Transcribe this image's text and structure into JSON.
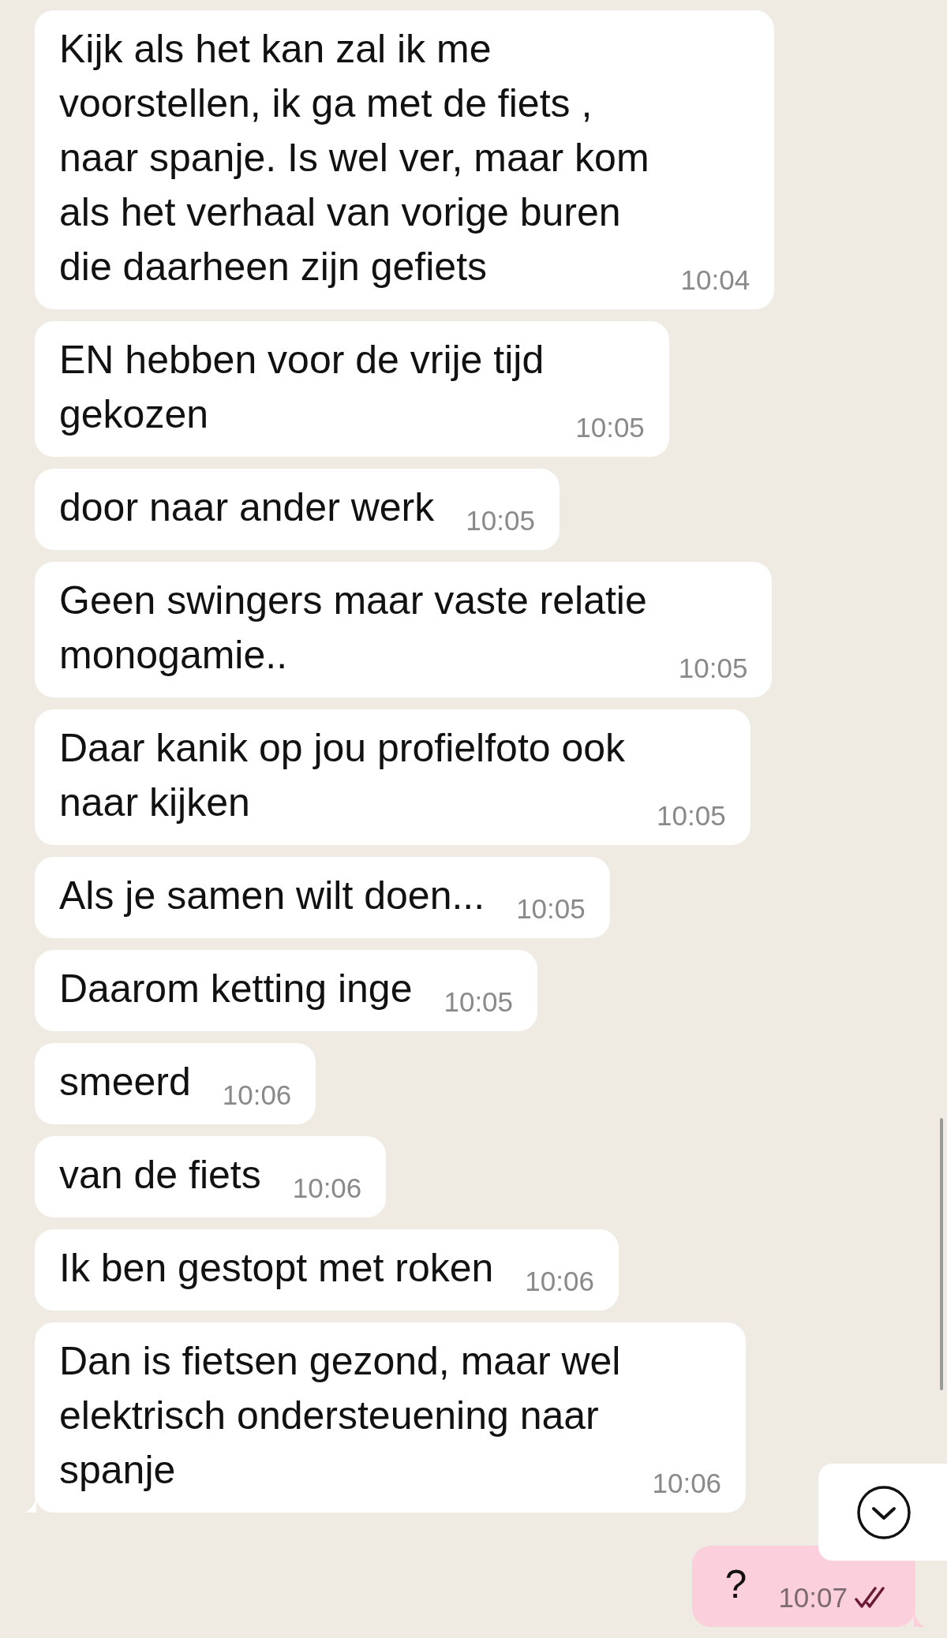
{
  "messages": [
    {
      "kind": "incoming",
      "text": "Kijk als het kan zal ik me\nvoorstellen, ik ga met de fiets ,\nnaar spanje. Is wel ver, maar kom\nals het verhaal van vorige buren\ndie daarheen zijn gefiets",
      "time": "10:04"
    },
    {
      "kind": "incoming",
      "text": "EN hebben voor de vrije tijd\ngekozen",
      "time": "10:05"
    },
    {
      "kind": "incoming",
      "text": "door naar ander werk",
      "time": "10:05"
    },
    {
      "kind": "incoming",
      "text": "Geen swingers maar vaste relatie\nmonogamie..",
      "time": "10:05"
    },
    {
      "kind": "incoming",
      "text": "Daar kanik op jou profielfoto ook\nnaar kijken",
      "time": "10:05"
    },
    {
      "kind": "incoming",
      "text": "Als je samen wilt doen...",
      "time": "10:05"
    },
    {
      "kind": "incoming",
      "text": "Daarom ketting inge",
      "time": "10:05"
    },
    {
      "kind": "incoming",
      "text": "smeerd",
      "time": "10:06"
    },
    {
      "kind": "incoming",
      "text": "van de fiets",
      "time": "10:06"
    },
    {
      "kind": "incoming",
      "text": "Ik ben gestopt met roken",
      "time": "10:06"
    },
    {
      "kind": "incoming",
      "text": "Dan is fietsen gezond, maar wel\nelektrisch ondersteuening naar\nspanje",
      "time": "10:06"
    },
    {
      "kind": "outgoing",
      "text": "?",
      "time": "10:07",
      "read": true
    }
  ]
}
